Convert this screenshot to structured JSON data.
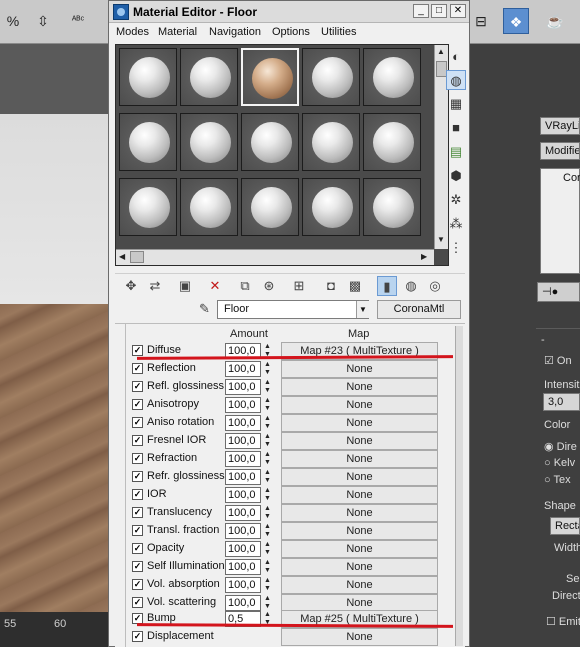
{
  "background": {
    "ruler_left": "55",
    "ruler_mid": "60",
    "right_panel": {
      "light_name": "VRayLig",
      "modifier": "Modifier",
      "cor": "Cor",
      "on_label": "On",
      "intensity_label": "Intensit",
      "intensity_value": "3,0",
      "color_label": "Color",
      "color_options": [
        "Dire",
        "Kelv",
        "Tex"
      ],
      "shape_label": "Shape",
      "shape_value": "Recta",
      "width_label": "Width",
      "s_label": "Se",
      "direct_label": "Direct",
      "emit_label": "Emit"
    }
  },
  "window": {
    "title": "Material Editor - Floor",
    "controls": [
      "_",
      "□",
      "✕"
    ],
    "menu": [
      "Modes",
      "Material",
      "Navigation",
      "Options",
      "Utilities"
    ]
  },
  "material": {
    "name": "Floor",
    "type": "CoronaMtl"
  },
  "maps": {
    "header_amount": "Amount",
    "header_map": "Map",
    "rows": [
      {
        "label": "Diffuse",
        "amount": "100,0",
        "map": "Map #23  ( MultiTexture )"
      },
      {
        "label": "Reflection",
        "amount": "100,0",
        "map": "None"
      },
      {
        "label": "Refl. glossiness",
        "amount": "100,0",
        "map": "None"
      },
      {
        "label": "Anisotropy",
        "amount": "100,0",
        "map": "None"
      },
      {
        "label": "Aniso rotation",
        "amount": "100,0",
        "map": "None"
      },
      {
        "label": "Fresnel IOR",
        "amount": "100,0",
        "map": "None"
      },
      {
        "label": "Refraction",
        "amount": "100,0",
        "map": "None"
      },
      {
        "label": "Refr. glossiness",
        "amount": "100,0",
        "map": "None"
      },
      {
        "label": "IOR",
        "amount": "100,0",
        "map": "None"
      },
      {
        "label": "Translucency",
        "amount": "100,0",
        "map": "None"
      },
      {
        "label": "Transl. fraction",
        "amount": "100,0",
        "map": "None"
      },
      {
        "label": "Opacity",
        "amount": "100,0",
        "map": "None"
      },
      {
        "label": "Self Illumination",
        "amount": "100,0",
        "map": "None"
      },
      {
        "label": "Vol. absorption",
        "amount": "100,0",
        "map": "None"
      },
      {
        "label": "Vol. scattering",
        "amount": "100,0",
        "map": "None"
      },
      {
        "label": "Bump",
        "amount": "0,5",
        "map": "Map #25  ( MultiTexture )"
      },
      {
        "label": "Displacement",
        "amount": "",
        "map": "None"
      }
    ]
  },
  "accent": {
    "highlight_red": "#d3141c",
    "active_blue": "#6b9ad3"
  }
}
